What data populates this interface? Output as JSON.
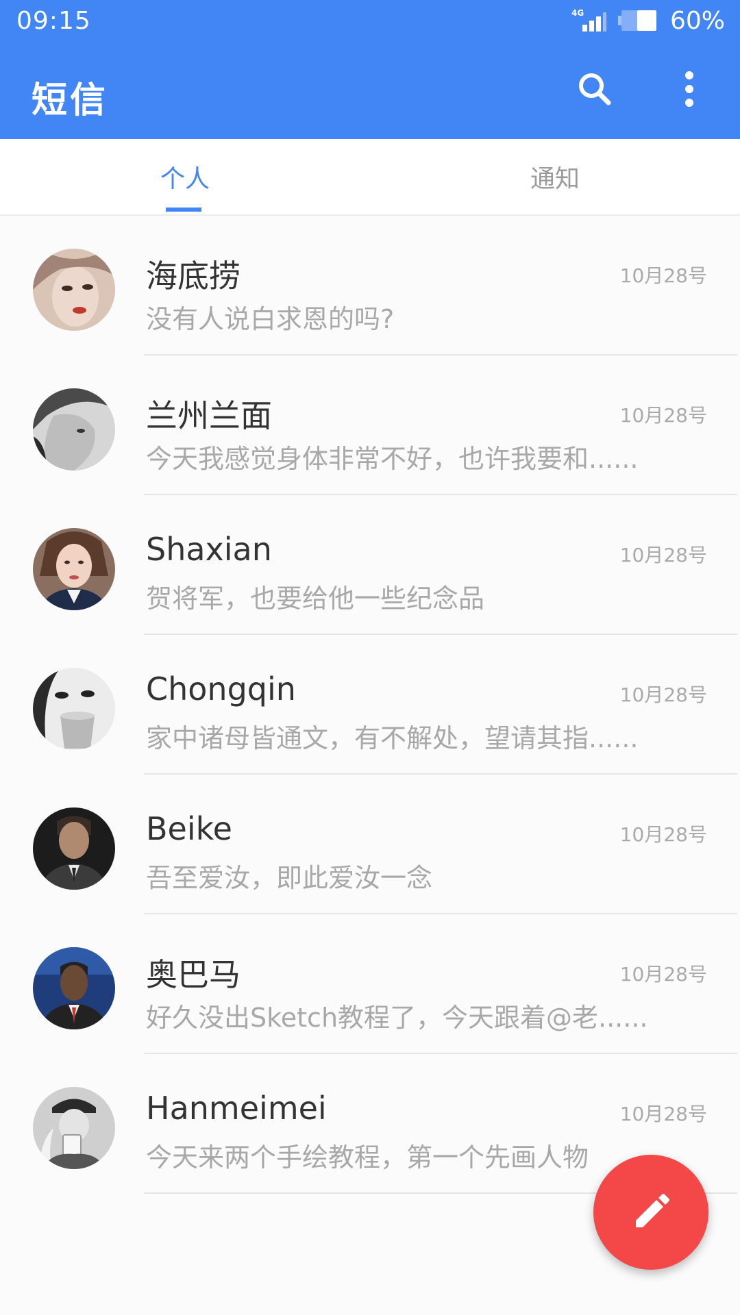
{
  "status_bar": {
    "time": "09:15",
    "network": "4G",
    "battery_percent": "60%",
    "battery_level": 0.6
  },
  "app_bar": {
    "title": "短信",
    "background_color": "#4285f4",
    "actions": [
      "search-icon",
      "more-vert-icon"
    ]
  },
  "tabs": [
    {
      "label": "个人",
      "active": true
    },
    {
      "label": "通知",
      "active": false
    }
  ],
  "conversations": [
    {
      "name": "海底捞",
      "date": "10月28号",
      "preview": "没有人说白求恩的吗?"
    },
    {
      "name": "兰州兰面",
      "date": "10月28号",
      "preview": "今天我感觉身体非常不好，也许我要和......"
    },
    {
      "name": "Shaxian",
      "date": "10月28号",
      "preview": "贺将军，也要给他一些纪念品"
    },
    {
      "name": "Chongqin",
      "date": "10月28号",
      "preview": "家中诸母皆通文，有不解处，望请其指......"
    },
    {
      "name": "Beike",
      "date": "10月28号",
      "preview": "吾至爱汝，即此爱汝一念"
    },
    {
      "name": "奥巴马",
      "date": "10月28号",
      "preview": "好久没出Sketch教程了，今天跟着@老......"
    },
    {
      "name": "Hanmeimei",
      "date": "10月28号",
      "preview": "今天来两个手绘教程，第一个先画人物"
    }
  ],
  "fab": {
    "icon": "edit-pencil-icon",
    "color": "#f44848"
  }
}
